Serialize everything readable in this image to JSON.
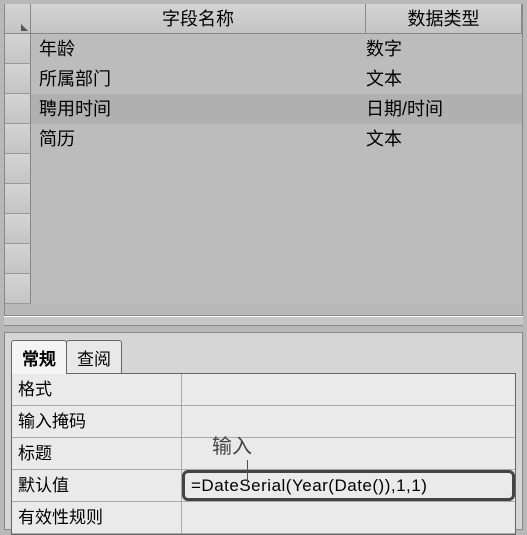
{
  "grid": {
    "headers": {
      "name": "字段名称",
      "type": "数据类型"
    },
    "rows": [
      {
        "name": "年龄",
        "type": "数字"
      },
      {
        "name": "所属部门",
        "type": "文本"
      },
      {
        "name": "聘用时间",
        "type": "日期/时间"
      },
      {
        "name": "简历",
        "type": "文本"
      }
    ],
    "selected_index": 2
  },
  "tabs": {
    "general": "常规",
    "lookup": "查阅",
    "active": "general"
  },
  "properties": {
    "format": {
      "label": "格式",
      "value": ""
    },
    "input_mask": {
      "label": "输入掩码",
      "value": ""
    },
    "caption": {
      "label": "标题",
      "value": ""
    },
    "default_value": {
      "label": "默认值",
      "value": "=DateSerial(Year(Date()),1,1)"
    },
    "validation": {
      "label": "有效性规则",
      "value": ""
    }
  },
  "callout": "输入"
}
